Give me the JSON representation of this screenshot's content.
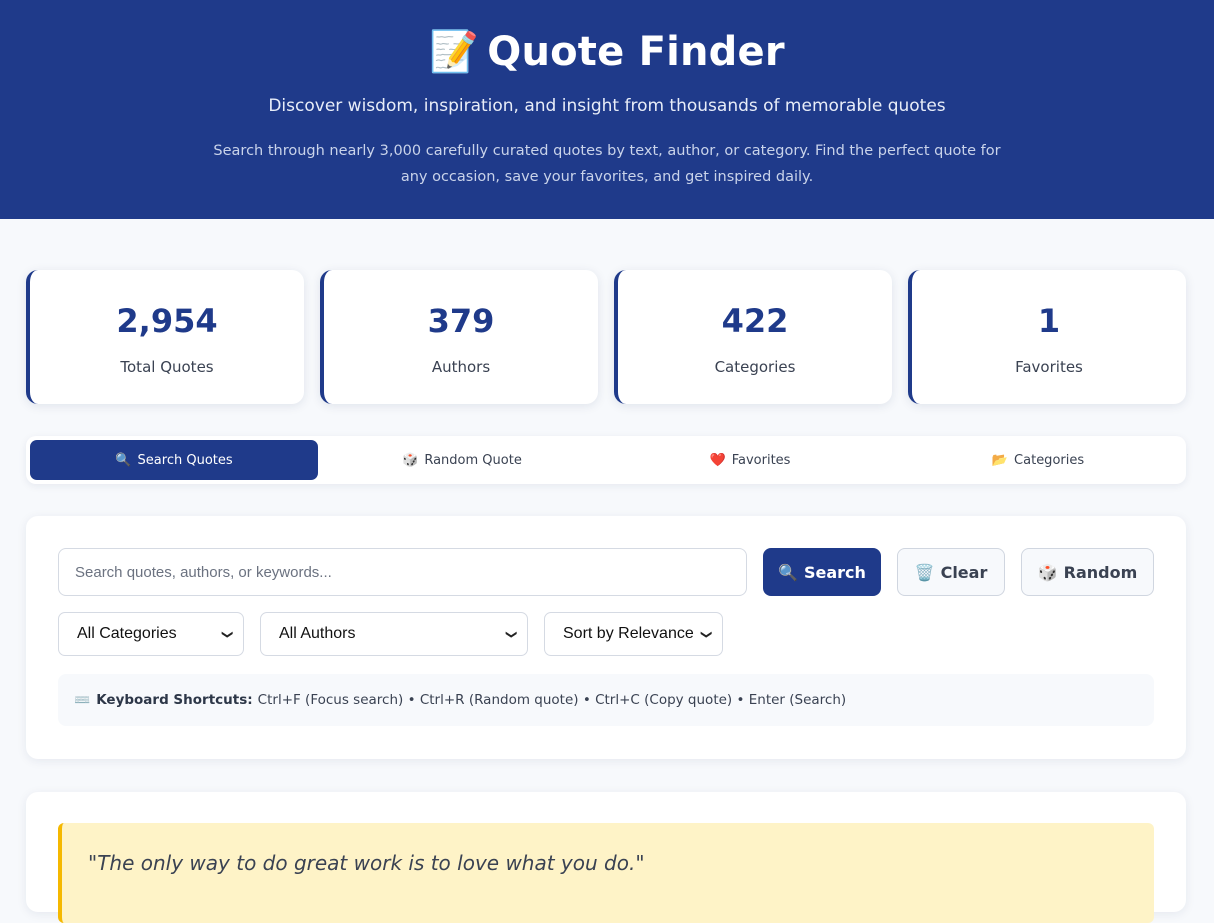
{
  "header": {
    "emoji": "📝",
    "title": "Quote Finder",
    "subtitle": "Discover wisdom, inspiration, and insight from thousands of memorable quotes",
    "description": "Search through nearly 3,000 carefully curated quotes by text, author, or category. Find the perfect quote for any occasion, save your favorites, and get inspired daily."
  },
  "stats": [
    {
      "value": "2,954",
      "label": "Total Quotes"
    },
    {
      "value": "379",
      "label": "Authors"
    },
    {
      "value": "422",
      "label": "Categories"
    },
    {
      "value": "1",
      "label": "Favorites"
    }
  ],
  "tabs": [
    {
      "icon": "🔍",
      "label": "Search Quotes",
      "active": true
    },
    {
      "icon": "🎲",
      "label": "Random Quote",
      "active": false
    },
    {
      "icon": "❤️",
      "label": "Favorites",
      "active": false
    },
    {
      "icon": "📂",
      "label": "Categories",
      "active": false
    }
  ],
  "search": {
    "placeholder": "Search quotes, authors, or keywords...",
    "value": "",
    "search_button": {
      "icon": "🔍",
      "label": "Search"
    },
    "clear_button": {
      "icon": "🗑️",
      "label": "Clear"
    },
    "random_button": {
      "icon": "🎲",
      "label": "Random"
    }
  },
  "filters": {
    "category": "All Categories",
    "author": "All Authors",
    "sort": "Sort by Relevance"
  },
  "shortcuts": {
    "icon": "⌨️",
    "title": "Keyboard Shortcuts:",
    "text": "Ctrl+F (Focus search) • Ctrl+R (Random quote) • Ctrl+C (Copy quote) • Enter (Search)"
  },
  "quote": {
    "text": "\"The only way to do great work is to love what you do.\""
  },
  "colors": {
    "primary": "#1f3a8a",
    "quote_bg": "#fef3c7",
    "quote_accent": "#f5b800"
  }
}
